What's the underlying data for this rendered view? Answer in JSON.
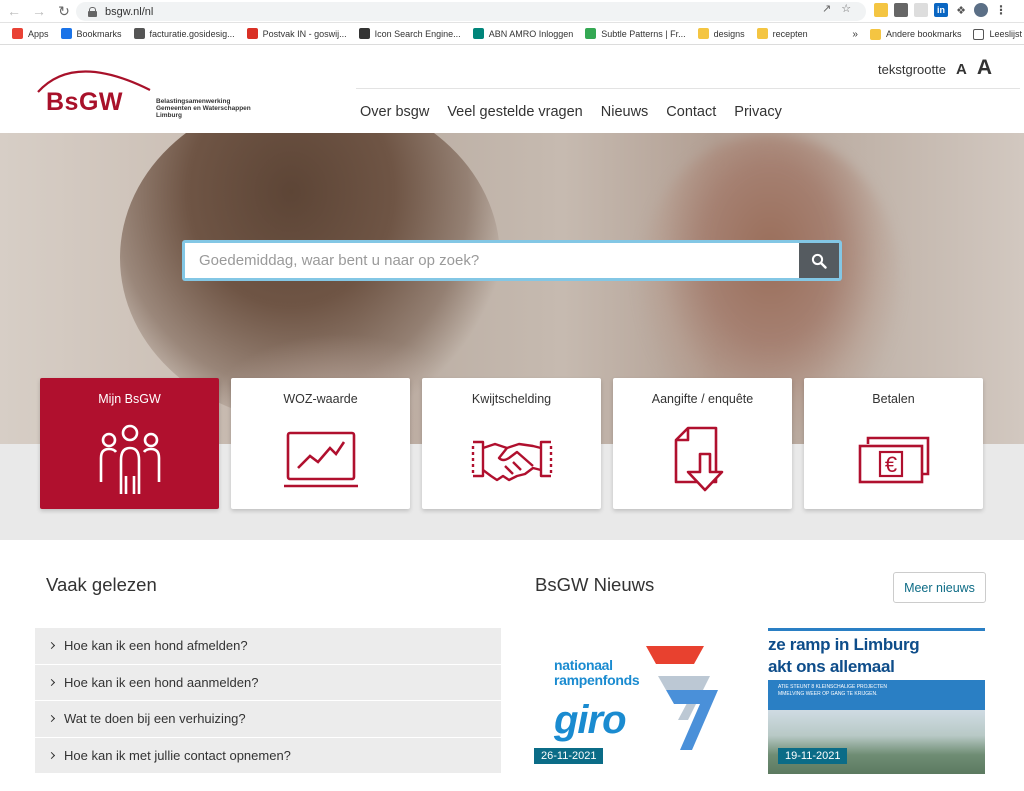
{
  "browser": {
    "url": "bsgw.nl/nl",
    "bookmarks": [
      {
        "label": "Apps",
        "color": "#e94235"
      },
      {
        "label": "Bookmarks",
        "color": "#1a73e8"
      },
      {
        "label": "facturatie.gosidesig...",
        "color": "#555555"
      },
      {
        "label": "Postvak IN - goswij...",
        "color": "#d93025"
      },
      {
        "label": "Icon Search Engine...",
        "color": "#333333"
      },
      {
        "label": "ABN AMRO Inloggen",
        "color": "#00857a"
      },
      {
        "label": "Subtle Patterns | Fr...",
        "color": "#34a853"
      },
      {
        "label": "designs",
        "color": "#f4c542"
      },
      {
        "label": "recepten",
        "color": "#f4c542"
      }
    ],
    "bookmarks_overflow": "»",
    "other_bookmarks": "Andere bookmarks",
    "reading_list": "Leeslijst"
  },
  "header": {
    "logo_text": "BsGW",
    "logo_sub": [
      "Belastingsamenwerking",
      "Gemeenten en Waterschappen",
      "Limburg"
    ],
    "textsize_label": "tekstgrootte",
    "textsize_small": "A",
    "textsize_large": "A",
    "nav": [
      "Over bsgw",
      "Veel gestelde vragen",
      "Nieuws",
      "Contact",
      "Privacy"
    ]
  },
  "search": {
    "placeholder": "Goedemiddag, waar bent u naar op zoek?"
  },
  "tiles": [
    {
      "label": "Mijn BsGW",
      "icon": "people-icon",
      "active": true
    },
    {
      "label": "WOZ-waarde",
      "icon": "chart-screen-icon",
      "active": false
    },
    {
      "label": "Kwijtschelding",
      "icon": "handshake-icon",
      "active": false
    },
    {
      "label": "Aangifte / enquête",
      "icon": "document-download-icon",
      "active": false
    },
    {
      "label": "Betalen",
      "icon": "euro-banknote-icon",
      "active": false
    }
  ],
  "colors": {
    "brand": "#b0102e",
    "teal": "#0b6c87"
  },
  "vaak_gelezen": {
    "title": "Vaak gelezen",
    "items": [
      "Hoe kan ik een hond afmelden?",
      "Hoe kan ik een hond aanmelden?",
      "Wat te doen bij een verhuizing?",
      "Hoe kan ik met jullie contact opnemen?"
    ]
  },
  "news": {
    "title": "BsGW Nieuws",
    "more_label": "Meer nieuws",
    "cards": [
      {
        "date": "26-11-2021",
        "image_text_small": "nationaal\nrampenfonds",
        "image_text_big": "giro"
      },
      {
        "date": "19-11-2021",
        "image_head": "ze ramp in Limburg\nakt ons allemaal",
        "image_band": "ATIE STEUNT 8 KLEINSCHALIGE PROJECTEN\nMMELVING WEER OP GANG TE KRIJGEN."
      }
    ]
  }
}
